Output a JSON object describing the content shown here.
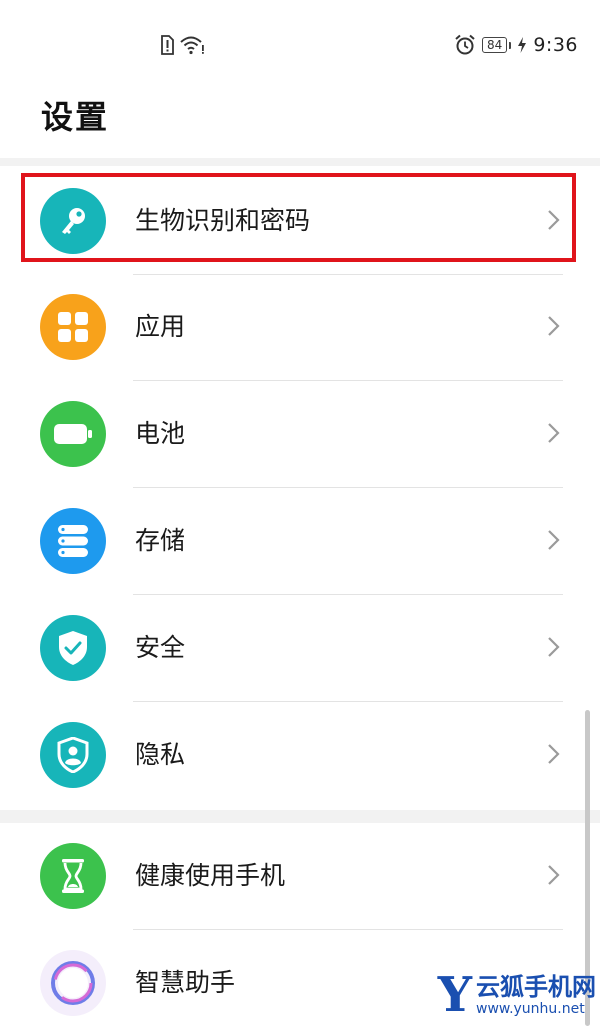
{
  "status_bar": {
    "notification_icon": "sim-alert-icon",
    "wifi_icon": "wifi-icon",
    "alarm_icon": "alarm-icon",
    "battery_level": "84",
    "time": "9:36"
  },
  "header": {
    "title": "设置"
  },
  "settings": {
    "items": [
      {
        "label": "生物识别和密码",
        "icon": "key-icon",
        "color": "#17b5b9"
      },
      {
        "label": "应用",
        "icon": "apps-grid-icon",
        "color": "#f8a21b"
      },
      {
        "label": "电池",
        "icon": "battery-icon",
        "color": "#3cc24d"
      },
      {
        "label": "存储",
        "icon": "storage-icon",
        "color": "#1e9aee"
      },
      {
        "label": "安全",
        "icon": "shield-check-icon",
        "color": "#17b5b9"
      },
      {
        "label": "隐私",
        "icon": "privacy-icon",
        "color": "#17b5b9"
      },
      {
        "label": "健康使用手机",
        "icon": "hourglass-icon",
        "color": "#3cc24d"
      },
      {
        "label": "智慧助手",
        "icon": "assistant-icon",
        "color": "#b27be6"
      }
    ]
  },
  "highlight": {
    "color": "#e0141b"
  },
  "watermark": {
    "logo_letter": "Y",
    "name": "云狐手机网",
    "url": "www.yunhu.net"
  }
}
